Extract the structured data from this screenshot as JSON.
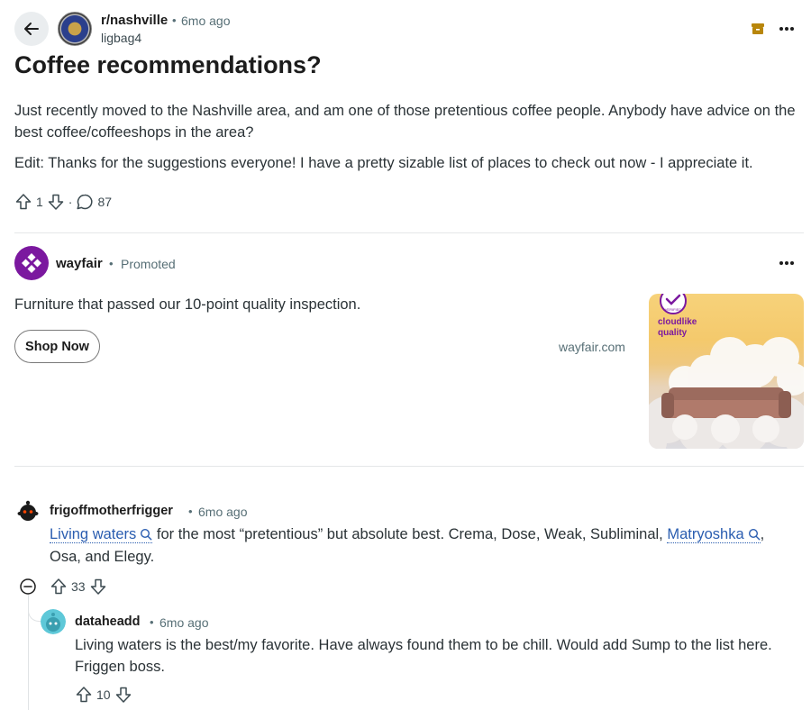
{
  "post": {
    "subreddit": "r/nashville",
    "time": "6mo ago",
    "author": "ligbag4",
    "title": "Coffee recommendations?",
    "body_p1": "Just recently moved to the Nashville area, and am one of those pretentious coffee people. Anybody have advice on the best coffee/coffeeshops in the area?",
    "body_p2": "Edit: Thanks for the suggestions everyone! I have a pretty sizable list of places to check out now - I appreciate it.",
    "score": "1",
    "comments": "87"
  },
  "ad": {
    "advertiser": "wayfair",
    "label": "Promoted",
    "text": "Furniture that passed our 10-point quality inspection.",
    "cta": "Shop Now",
    "domain": "wayfair.com",
    "image_caption": "cloudlike quality",
    "badge_text": "VERIFIED"
  },
  "comments": [
    {
      "user": "frigoffmotherfrigger",
      "time": "6mo ago",
      "link1": "Living waters",
      "text1": " for the most “pretentious” but absolute best. Crema, Dose, Weak, Subliminal, ",
      "link2": "Matryoshka",
      "text2": ", Osa, and Elegy.",
      "score": "33"
    },
    {
      "user": "dataheadd",
      "time": "6mo ago",
      "body": "Living waters is the best/my favorite. Have always found them to be chill. Would add Sump to the list here. Friggen boss.",
      "score": "10"
    }
  ],
  "colors": {
    "link": "#2a5db0",
    "wayfair_purple": "#7b189f",
    "archive_gold": "#b8860b",
    "meta_gray": "#576f76"
  },
  "icons": [
    "back-arrow-icon",
    "archive-icon",
    "more-icon",
    "upvote-icon",
    "downvote-icon",
    "comment-icon",
    "search-icon",
    "collapse-icon"
  ]
}
